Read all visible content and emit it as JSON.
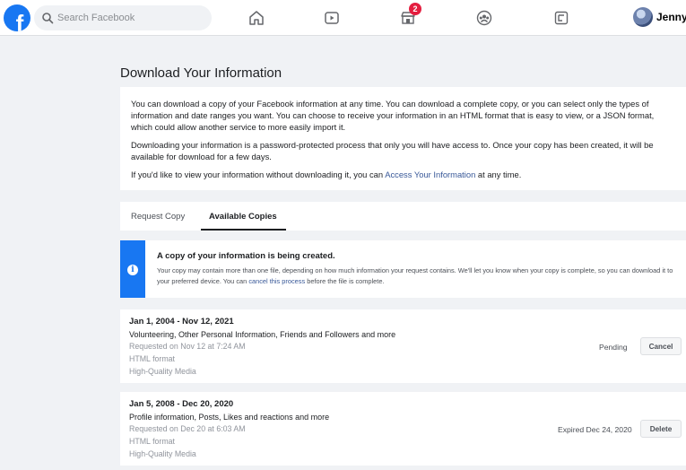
{
  "nav": {
    "search_placeholder": "Search Facebook",
    "notifications_badge": "2",
    "profile_name": "Jenny",
    "logo_letter": "f",
    "icons": [
      "home-icon",
      "watch-icon",
      "marketplace-icon",
      "groups-icon",
      "gaming-icon"
    ]
  },
  "page": {
    "title": "Download Your Information"
  },
  "intro": {
    "p1": "You can download a copy of your Facebook information at any time. You can download a complete copy, or you can select only the types of information and date ranges you want. You can choose to receive your information in an HTML format that is easy to view, or a JSON format, which could allow another service to more easily import it.",
    "p2": "Downloading your information is a password-protected process that only you will have access to. Once your copy has been created, it will be available for download for a few days.",
    "p3_before": "If you'd like to view your information without downloading it, you can ",
    "p3_link": "Access Your Information",
    "p3_after": " at any time."
  },
  "tabs": [
    {
      "label": "Request Copy",
      "active": false
    },
    {
      "label": "Available Copies",
      "active": true
    }
  ],
  "notice": {
    "title": "A copy of your information is being created.",
    "body_before": "Your copy may contain more than one file, depending on how much information your request contains. We'll let you know when your copy is complete, so you can download it to your preferred device. You can ",
    "link": "cancel this process",
    "body_after": " before the file is complete."
  },
  "copies": [
    {
      "range": "Jan 1, 2004 - Nov 12, 2021",
      "categories": "Volunteering, Other Personal Information, Friends and Followers and more",
      "requested": "Requested on Nov 12 at 7:24 AM",
      "format": "HTML format",
      "media": "High-Quality Media",
      "status": "Pending",
      "action": "Cancel"
    },
    {
      "range": "Jan 5, 2008 - Dec 20, 2020",
      "categories": "Profile information, Posts, Likes and reactions and more",
      "requested": "Requested on Dec 20 at 6:03 AM",
      "format": "HTML format",
      "media": "High-Quality Media",
      "status": "Expired Dec 24, 2020",
      "action": "Delete"
    }
  ],
  "colors": {
    "brand": "#1877f2",
    "background": "#f0f2f5",
    "link": "#385898",
    "badge": "#e41e3f"
  }
}
